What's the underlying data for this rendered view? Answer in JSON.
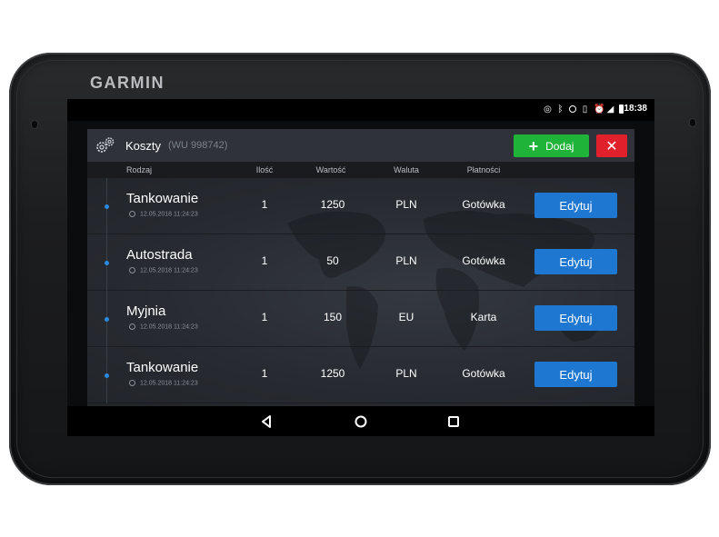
{
  "device": {
    "brand": "GARMIN"
  },
  "statusbar": {
    "time": "18:38",
    "icons": [
      "hotspot-icon",
      "bluetooth-icon",
      "dnd-icon",
      "vibrate-icon",
      "alarm-icon",
      "signal-icon",
      "battery-icon"
    ]
  },
  "header": {
    "title": "Koszty",
    "subtitle": "(WU 998742)",
    "add_label": "Dodaj",
    "close_label": "✕",
    "icon": "gears-icon"
  },
  "columns": {
    "type": "Rodzaj",
    "qty": "Ilość",
    "value": "Wartość",
    "currency": "Waluta",
    "payment": "Płatności"
  },
  "rows": [
    {
      "name": "Tankowanie",
      "date": "12.05.2018 11:24:23",
      "qty": "1",
      "value": "1250",
      "currency": "PLN",
      "payment": "Gotówka",
      "edit": "Edytuj"
    },
    {
      "name": "Autostrada",
      "date": "12.05.2018 11:24:23",
      "qty": "1",
      "value": "50",
      "currency": "PLN",
      "payment": "Gotówka",
      "edit": "Edytuj"
    },
    {
      "name": "Myjnia",
      "date": "12.05.2018 11:24:23",
      "qty": "1",
      "value": "150",
      "currency": "EU",
      "payment": "Karta",
      "edit": "Edytuj"
    },
    {
      "name": "Tankowanie",
      "date": "12.05.2018 11:24:23",
      "qty": "1",
      "value": "1250",
      "currency": "PLN",
      "payment": "Gotówka",
      "edit": "Edytuj"
    }
  ],
  "navbar": {
    "icons": [
      "back-icon",
      "home-icon",
      "recents-icon"
    ]
  },
  "colors": {
    "add": "#1fb33a",
    "close": "#e0202a",
    "edit": "#1e77d0",
    "bullet": "#2a8be0"
  }
}
